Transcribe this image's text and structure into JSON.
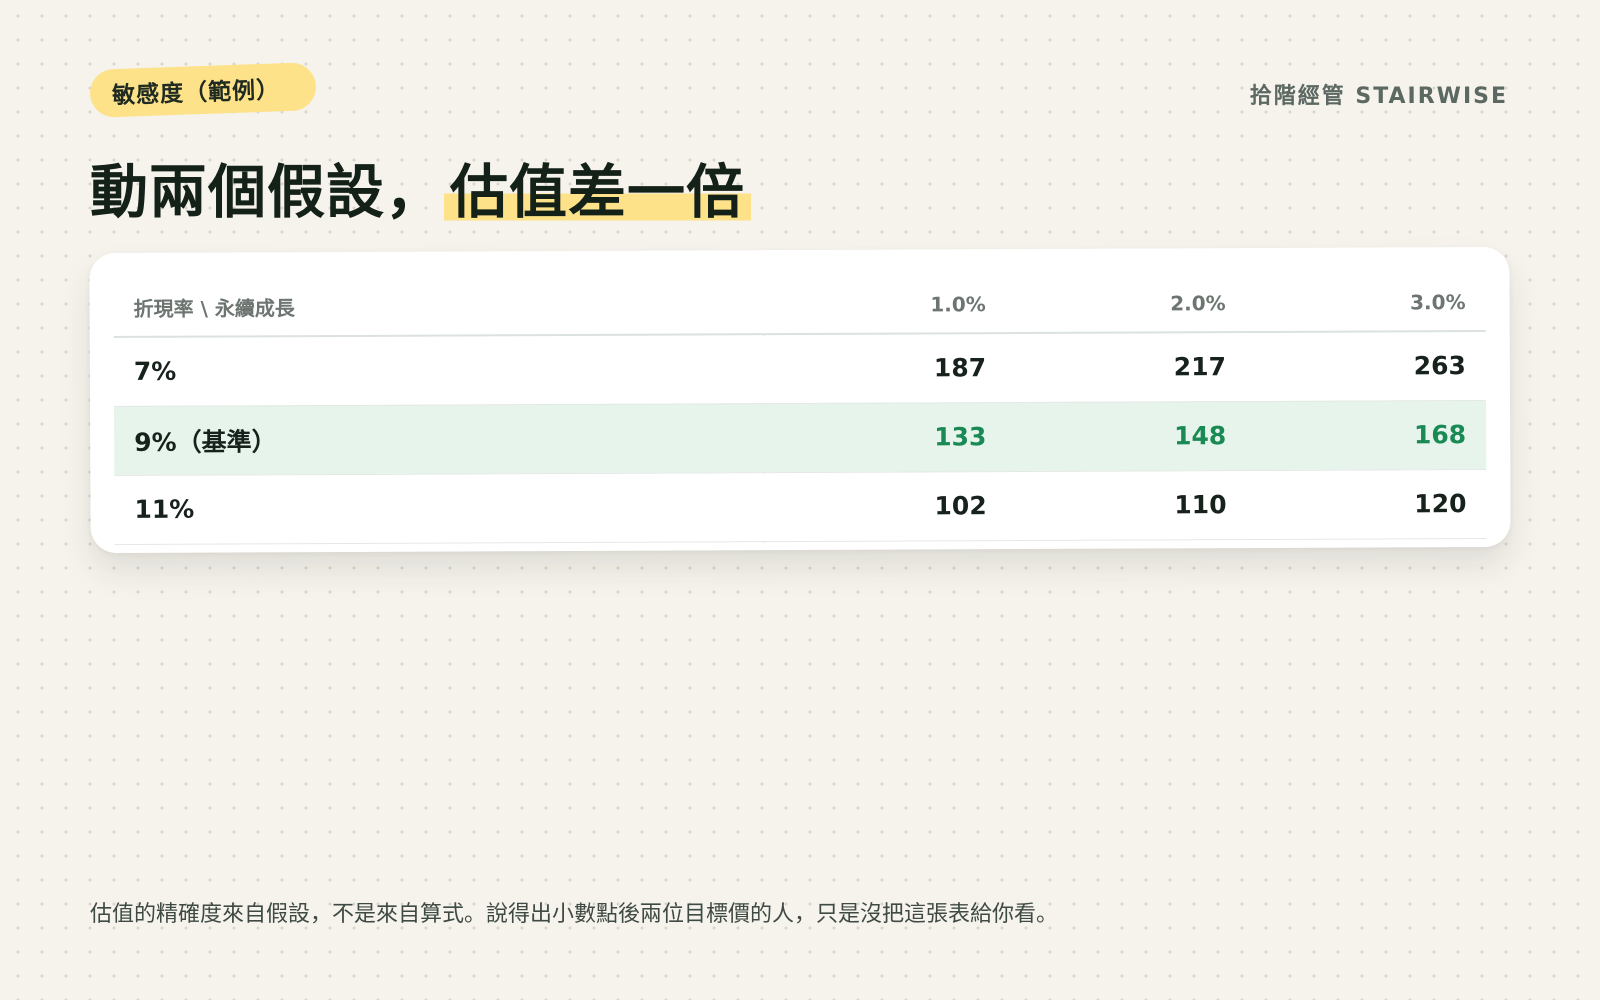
{
  "tag": {
    "label": "敏感度（範例）"
  },
  "brand": {
    "label": "拾階經管 STAIRWISE"
  },
  "headline": {
    "part1": "動兩個假設，",
    "highlight": "估值差一倍"
  },
  "table": {
    "corner_header": "折現率 \\ 永續成長",
    "columns": [
      "1.0%",
      "2.0%",
      "3.0%"
    ],
    "rows": [
      {
        "label": "7%",
        "values": [
          "187",
          "217",
          "263"
        ]
      },
      {
        "label": "9%（基準）",
        "values": [
          "133",
          "148",
          "168"
        ]
      },
      {
        "label": "11%",
        "values": [
          "102",
          "110",
          "120"
        ]
      }
    ],
    "highlight_color": "#e6f4ec",
    "highlight_text_color": "#1a8a55"
  },
  "footer": {
    "text": "估值的精確度來自假設，不是來自算式。說得出小數點後兩位目標價的人，只是沒把這張表給你看。"
  },
  "colors": {
    "background": "#f5f3ec",
    "accent_yellow": "#fde28a",
    "ink": "#142118"
  }
}
